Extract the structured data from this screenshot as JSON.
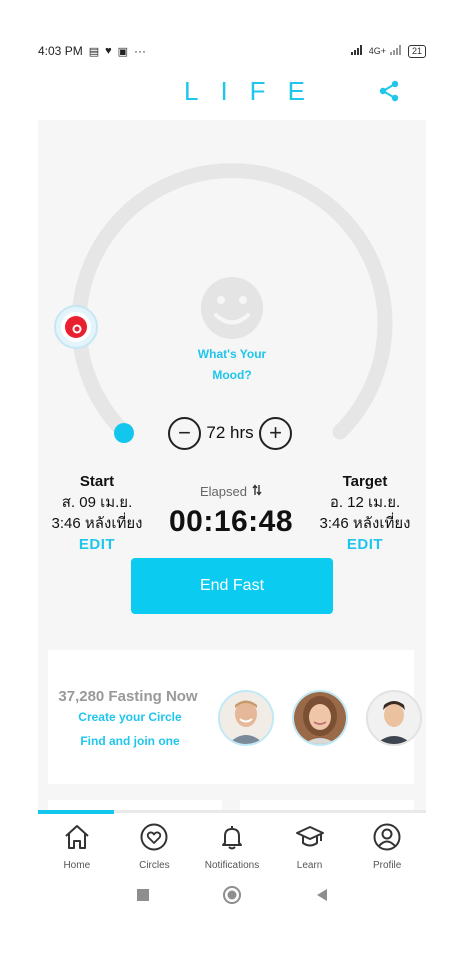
{
  "status_bar": {
    "time": "4:03 PM",
    "notification_icons": [
      "notes-icon",
      "heart-pulse-icon",
      "app-icon"
    ],
    "more": "···",
    "network": "4G+",
    "battery": "21"
  },
  "header": {
    "logo": "LIFE",
    "share_icon": "share-icon"
  },
  "timer": {
    "mood_line1": "What's Your",
    "mood_line2": "Mood?",
    "decrease_symbol": "−",
    "increase_symbol": "+",
    "duration": "72 hrs",
    "progress_fraction": 0.01
  },
  "start": {
    "title": "Start",
    "date": "ส. 09 เม.ย.",
    "time": "3:46 หลังเที่ยง",
    "edit": "EDIT"
  },
  "target": {
    "title": "Target",
    "date": "อ. 12 เม.ย.",
    "time": "3:46 หลังเที่ยง",
    "edit": "EDIT"
  },
  "elapsed": {
    "label": "Elapsed",
    "swap_icon": "swap-vertical-icon",
    "value": "00:16:48"
  },
  "end_fast_button": "End Fast",
  "circles_card": {
    "count_text": "37,280 Fasting Now",
    "create_link": "Create your Circle",
    "find_link": "Find and join one"
  },
  "bottom_nav": {
    "items": [
      {
        "label": "Home",
        "icon": "home-icon"
      },
      {
        "label": "Circles",
        "icon": "heart-circle-icon"
      },
      {
        "label": "Notifications",
        "icon": "bell-icon"
      },
      {
        "label": "Learn",
        "icon": "graduation-cap-icon"
      },
      {
        "label": "Profile",
        "icon": "profile-icon"
      }
    ],
    "active": "Home"
  },
  "colors": {
    "accent": "#1fc6ec",
    "button": "#0bcbf0",
    "text": "#111111",
    "background": "#f6f6f6"
  }
}
